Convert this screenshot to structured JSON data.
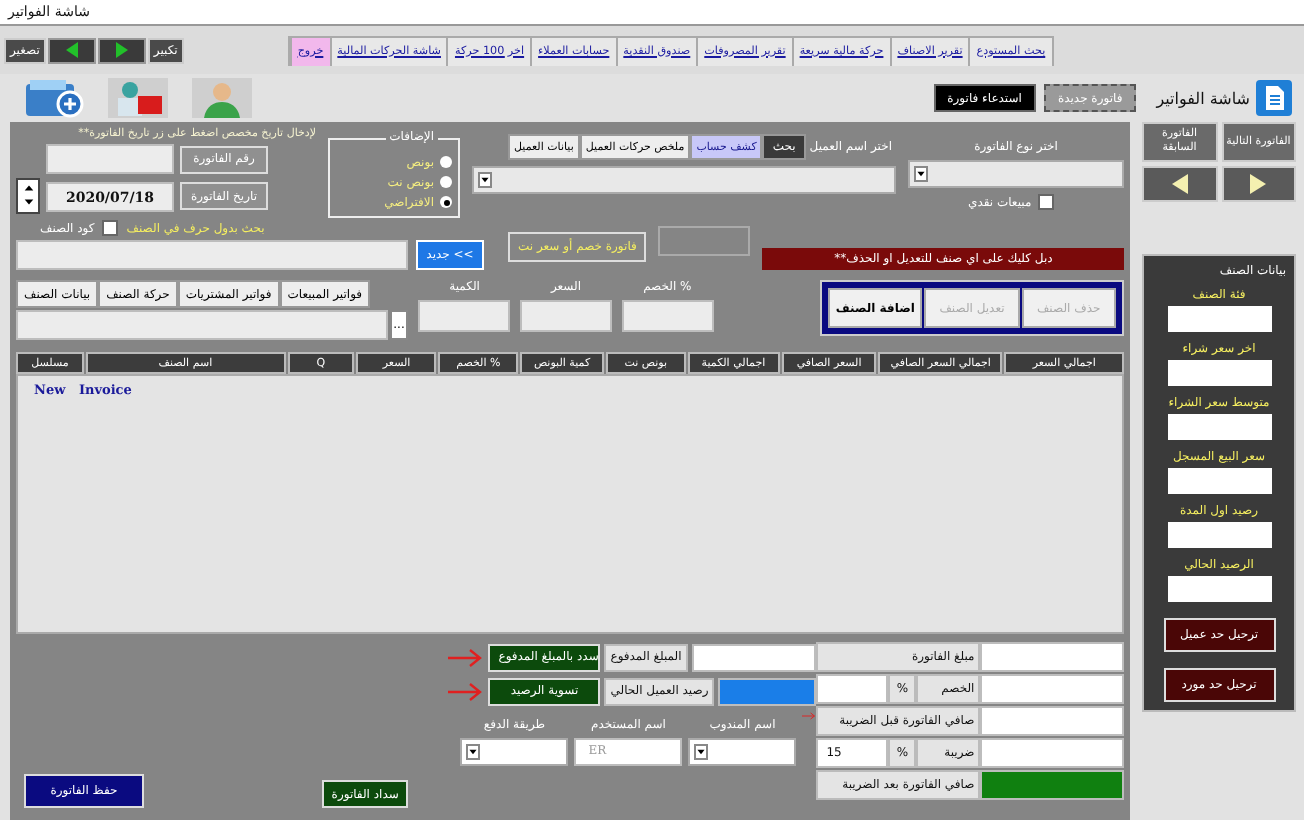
{
  "window": {
    "title": "شاشة الفواتير"
  },
  "window_controls": {
    "shrink": "تصغير",
    "enlarge": "تكبير"
  },
  "menu": [
    {
      "label": "بحث المستودع",
      "kind": "link"
    },
    {
      "label": "تقرير الاصناف",
      "kind": "link"
    },
    {
      "label": "حركة مالية سريعة",
      "kind": "link"
    },
    {
      "label": "تقرير المصروفات",
      "kind": "link"
    },
    {
      "label": "صندوق النقدية",
      "kind": "link"
    },
    {
      "label": "حسابات العملاء",
      "kind": "link"
    },
    {
      "label": "اخر 100 حركة",
      "kind": "link"
    },
    {
      "label": "شاشة الحركات المالية",
      "kind": "link"
    },
    {
      "label": "خروج",
      "kind": "exit"
    }
  ],
  "screen_title": "شاشة الفواتير",
  "invoice_actions": {
    "new": "فاتورة جديدة",
    "recall": "استدعاء فاتورة"
  },
  "invoice_header": {
    "date_hint": "**لإدخال تاريخ مخصص اضغط على زر تاريخ الفاتورة",
    "number_button": "رقم الفاتورة",
    "date_button": "تاريخ الفاتورة",
    "date": "2020/07/18"
  },
  "additions": {
    "title": "الإضافات",
    "options": [
      {
        "label": "بونص",
        "selected": false
      },
      {
        "label": "بونص نت",
        "selected": false
      },
      {
        "label": "الافتراضي",
        "selected": true
      }
    ]
  },
  "customer": {
    "label": "اختر اسم العميل",
    "search_button": "بحث",
    "tabs": [
      {
        "label": "كشف حساب",
        "selected": true
      },
      {
        "label": "ملخص حركات العميل",
        "selected": false
      },
      {
        "label": "بيانات العميل",
        "selected": false
      }
    ]
  },
  "invoice_type": {
    "label": "اختر نوع الفاتورة"
  },
  "cash_sale": {
    "label": "مبيعات نقدي",
    "checked": false
  },
  "letter_search": {
    "label": "بحث بدول حرف في الصنف",
    "checked": false
  },
  "item_code_label": "كود الصنف",
  "new_button": "جديد <<",
  "discount_note": "فاتورة خصم أو سعر نت",
  "edit_hint": "**دبل كليك على اي صنف للتعديل او الحذف",
  "item_tabs": [
    "فواتير المبيعات",
    "فواتير المشتريات",
    "حركة الصنف",
    "بيانات الصنف"
  ],
  "browse_button": "...",
  "entry_fields": [
    "الخصم %",
    "السعر",
    "الكمية"
  ],
  "item_actions": [
    {
      "label": "حذف الصنف",
      "disabled": true
    },
    {
      "label": "تعديل الصنف",
      "disabled": true
    },
    {
      "label": "اضافة الصنف",
      "disabled": false
    }
  ],
  "table": {
    "columns": [
      "اجمالي السعر",
      "اجمالي السعر الصافي",
      "السعر الصافي",
      "اجمالي الكمية",
      "بونص نت",
      "كمية البونص",
      "الخصم %",
      "السعر",
      "Q",
      "اسم الصنف",
      "مسلسل"
    ],
    "placeholder": "New   Invoice"
  },
  "totals": [
    {
      "label": "مبلغ الفاتورة",
      "kind": "plain"
    },
    {
      "label": "الخصم",
      "unit": "%",
      "kind": "percent"
    },
    {
      "label": "صافي الفاتورة قبل الضريبة",
      "kind": "plain"
    },
    {
      "label": "ضريبة",
      "unit": "%",
      "value": "15",
      "kind": "percent"
    },
    {
      "label": "صافي الفاتورة بعد الضريبة",
      "kind": "result"
    }
  ],
  "payment": {
    "paid_label": "المبلغ المدفوع",
    "balance_label": "رصيد العميل الحالي",
    "pay_button": "سدد بالمبلغ المدفوع",
    "settle_button": "تسوية الرصيد"
  },
  "footer": {
    "rep_label": "اسم المندوب",
    "user_label": "اسم المستخدم",
    "user_value": "ER",
    "method_label": "طريقة الدفع",
    "pay_invoice_button": "سداد الفاتورة",
    "save_button": "حفظ الفاتورة"
  },
  "sidebar": {
    "next": "الفاتورة التالية",
    "prev": "الفاتورة السابقة",
    "panel_title": "بيانات الصنف",
    "fields": [
      "فئة الصنف",
      "اخر سعر شراء",
      "متوسط سعر الشراء",
      "سعر البيع المسجل",
      "رصيد اول المدة",
      "الرصيد الحالي"
    ],
    "buttons": [
      "ترحيل حد عميل",
      "ترحيل حد مورد"
    ]
  }
}
